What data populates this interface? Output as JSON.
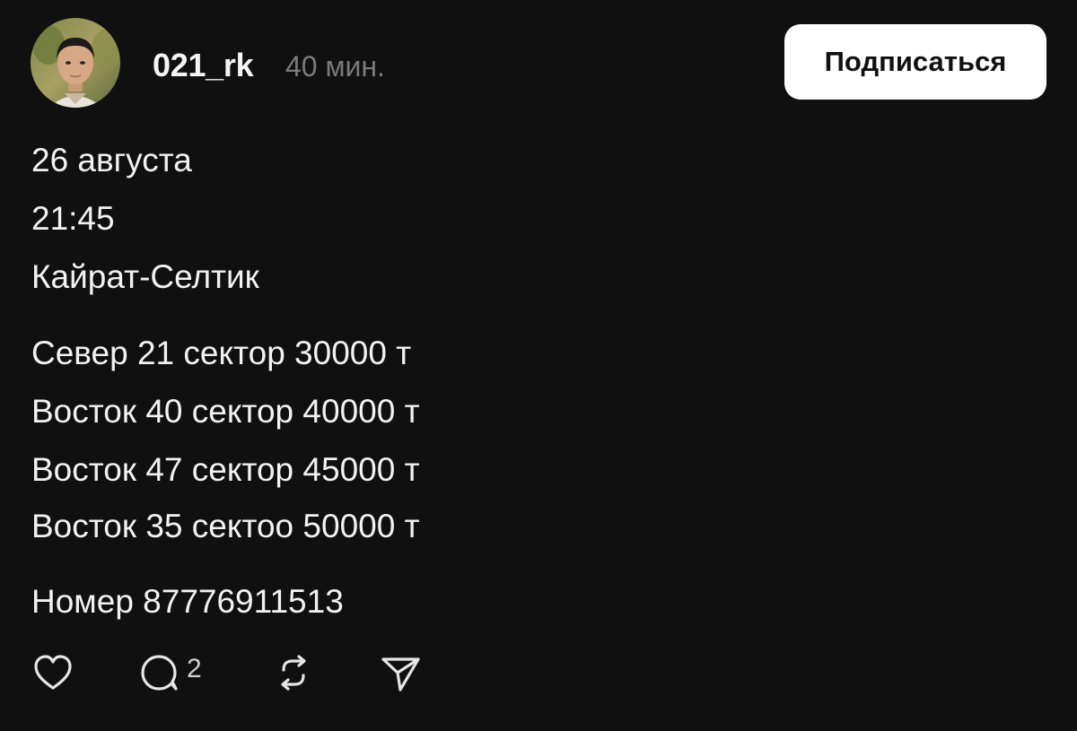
{
  "post": {
    "username": "021_rk",
    "time_ago": "40 мин.",
    "follow_label": "Подписаться",
    "lines": [
      "26 августа",
      "21:45",
      "Кайрат-Селтик",
      "Север 21 сектор 30000 т",
      "Восток 40 сектор 40000 т",
      "Восток 47 сектор 45000 т",
      "Восток 35 сектоо 50000 т",
      "Номер 87776911513"
    ]
  },
  "actions": {
    "like_icon": "heart-icon",
    "reply_icon": "comment-bubble-icon",
    "reply_count": "2",
    "repost_icon": "repost-icon",
    "share_icon": "send-icon"
  },
  "colors": {
    "background": "#101010",
    "text": "#f2f2f2",
    "muted": "#7a7a7a",
    "button_bg": "#ffffff",
    "button_text": "#111111"
  }
}
